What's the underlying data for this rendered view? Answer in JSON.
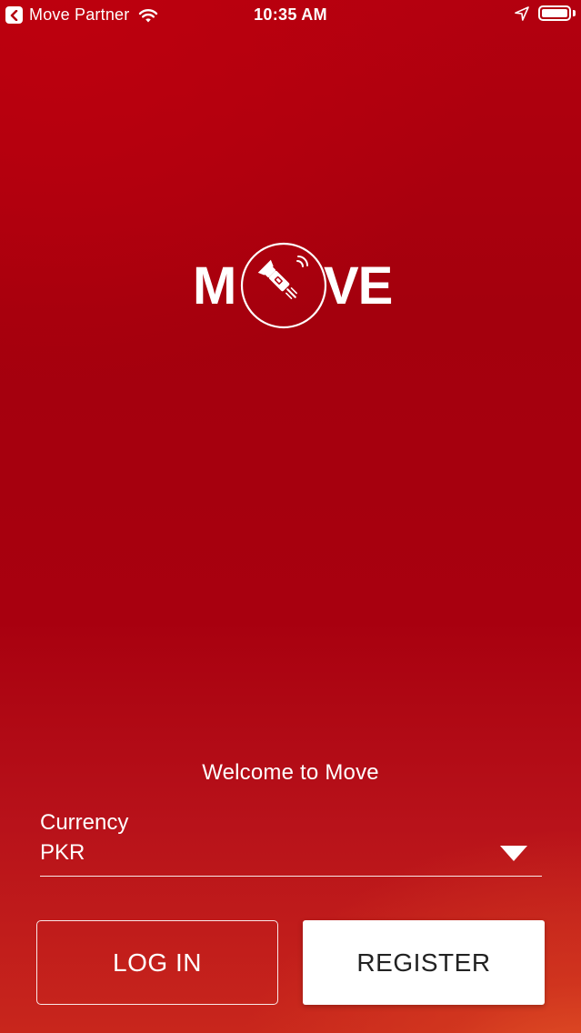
{
  "status_bar": {
    "back_app": "Move Partner",
    "time": "10:35 AM",
    "icons": [
      "back-icon",
      "wifi-icon",
      "location-arrow-icon",
      "battery-icon"
    ]
  },
  "logo": {
    "left_text": "M",
    "right_text": "VE",
    "emblem": "flashlight-icon"
  },
  "welcome_text": "Welcome to Move",
  "currency": {
    "label": "Currency",
    "selected": "PKR"
  },
  "buttons": {
    "login": "LOG IN",
    "register": "REGISTER"
  },
  "colors": {
    "background_top": "#a4000d",
    "background_bottom_accent": "#ec6228",
    "text": "#ffffff",
    "register_text": "#222222"
  }
}
